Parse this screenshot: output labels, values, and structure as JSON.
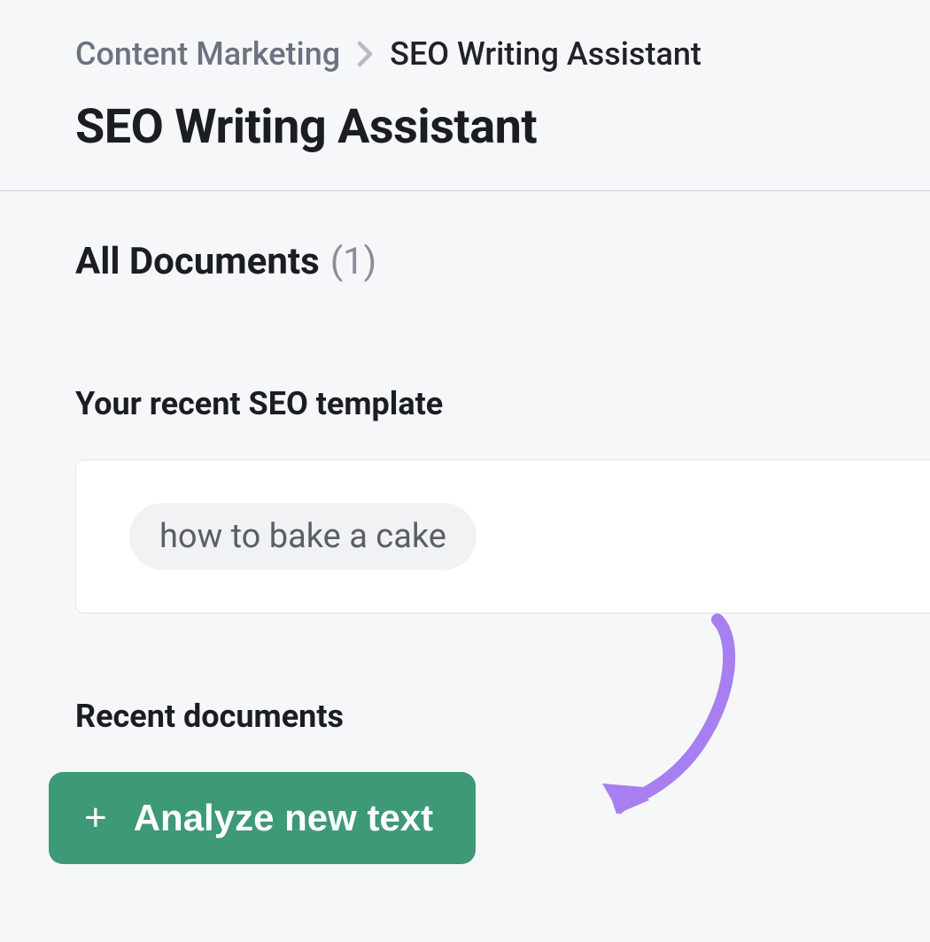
{
  "breadcrumb": {
    "parent": "Content Marketing",
    "current": "SEO Writing Assistant"
  },
  "page_title": "SEO Writing Assistant",
  "all_documents": {
    "label": "All Documents",
    "count": "(1)"
  },
  "recent_template": {
    "heading": "Your recent SEO template",
    "chip_label": "how to bake a cake"
  },
  "recent_documents": {
    "heading": "Recent documents",
    "analyze_button_label": "Analyze new text"
  },
  "colors": {
    "accent_green": "#3d9976",
    "annotation_purple": "#a77ff0"
  }
}
